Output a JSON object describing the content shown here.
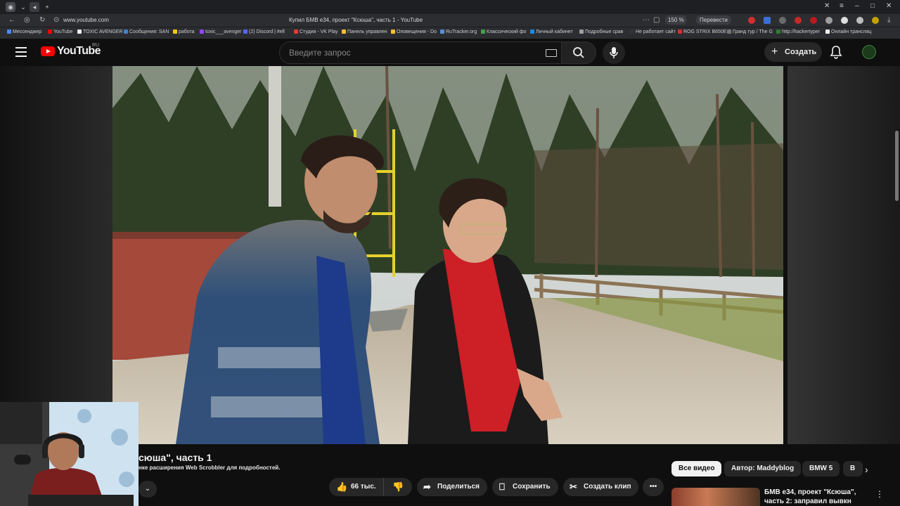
{
  "browser": {
    "url": "www.youtube.com",
    "page_title": "Купил БМВ е34, проект \"Ксюша\", часть 1 - YouTube",
    "zoom": "150 %",
    "translate_label": "Перевести",
    "bookmarks": [
      "Мессенджер",
      "YouTube",
      "TOXIC AVENGER",
      "Сообщения: SAN",
      "работа",
      "toxic___avenger",
      "(2) Discord | #ell",
      "Студия - VK Play",
      "Панель управлен",
      "Оповещения - Do",
      "RuTracker.org",
      "Классический фо",
      "Личный кабинет",
      "Подробные срав",
      "Не работает сайт",
      "ROG STRIX B650E",
      "Гранд тур / The G",
      "http://hackertyper",
      "Онлайн трансляц"
    ]
  },
  "youtube": {
    "logo_text": "YouTube",
    "country_code": "RU",
    "search_placeholder": "Введите запрос",
    "create_label": "Создать"
  },
  "video": {
    "title_visible": "сюша\", часть 1",
    "scrobbler_note": "нке расширения Web Scrobbler для подробностей.",
    "likes": "66 тыс.",
    "share_label": "Поделиться",
    "save_label": "Сохранить",
    "clip_label": "Создать клип"
  },
  "recommendations": {
    "chips": [
      "Все видео",
      "Автор: Maddyblog",
      "BMW 5",
      "В"
    ],
    "next_title": "БМВ е34, проект \"Ксюша\", часть 2: заправил вывкн"
  },
  "colors": {
    "youtube_red": "#ff0000",
    "background": "#0f0f0f",
    "button_bg": "#272727"
  }
}
